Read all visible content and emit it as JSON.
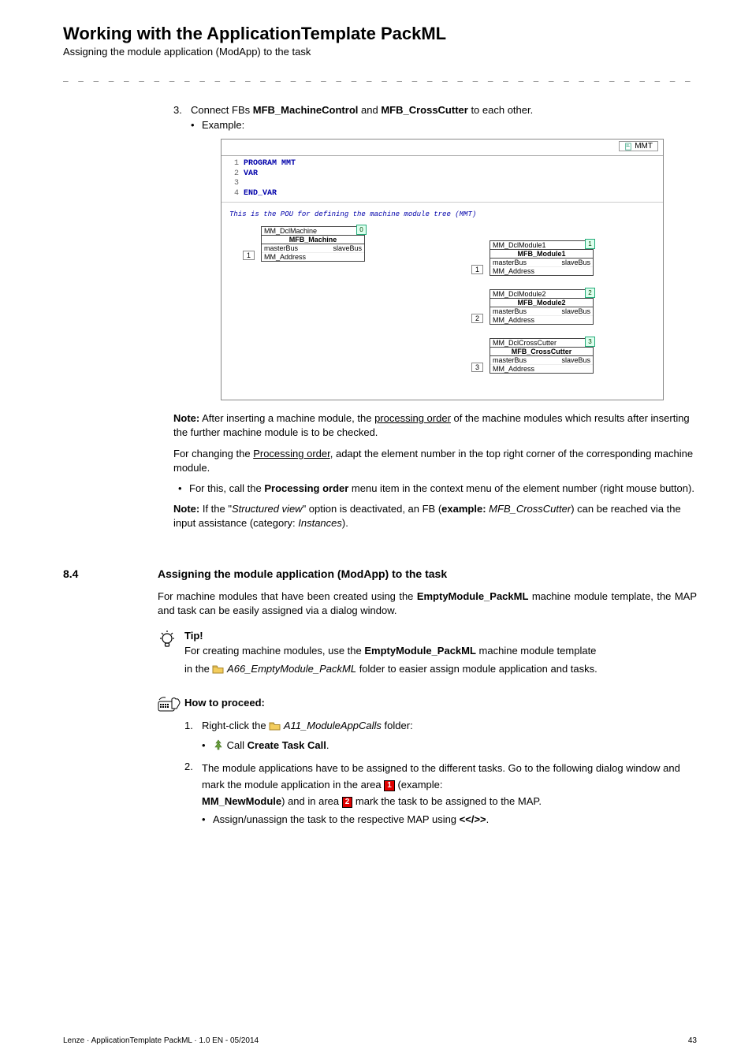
{
  "header": {
    "title": "Working with the ApplicationTemplate PackML",
    "subtitle": "Assigning the module application (ModApp) to the task"
  },
  "step3": {
    "num": "3.",
    "text_pre": "Connect FBs ",
    "fb1": "MFB_MachineControl",
    "text_mid": " and ",
    "fb2": "MFB_CrossCutter",
    "text_post": " to each other.",
    "example": "Example:"
  },
  "figure": {
    "tab": "MMT",
    "code_l1": "PROGRAM MMT",
    "code_l2": "VAR",
    "code_l3": "",
    "code_l4": "END_VAR",
    "pou_comment": "This is the POU for defining the machine module tree (MMT)",
    "blocks": [
      {
        "inst": "MM_DclMachine",
        "type": "MFB_Machine",
        "order": "0",
        "in": "1"
      },
      {
        "inst": "MM_DclModule1",
        "type": "MFB_Module1",
        "order": "1",
        "in": "1"
      },
      {
        "inst": "MM_DclModule2",
        "type": "MFB_Module2",
        "order": "2",
        "in": "2"
      },
      {
        "inst": "MM_DclCrossCutter",
        "type": "MFB_CrossCutter",
        "order": "3",
        "in": "3"
      }
    ],
    "port_l": "masterBus",
    "port_r": "slaveBus",
    "addr": "MM_Address"
  },
  "note1": {
    "label": "Note:",
    "t1": " After inserting a machine module, the ",
    "u1": "processing order",
    "t2": " of the machine modules which results after inserting the further machine module is to be checked."
  },
  "change": {
    "t1": "For changing the ",
    "u1": "Processing order",
    "t2": ", adapt the element number in the top right corner of the corresponding machine module."
  },
  "bullet_po": {
    "t1": "For this, call the ",
    "b1": "Processing order",
    "t2": " menu item in the context menu of the element number (right mouse button)."
  },
  "note2": {
    "label": "Note:",
    "t1": " If the \"",
    "i1": "Structured view",
    "t2": "\" option is deactivated, an FB (",
    "b1": "example:",
    "t3": " ",
    "i2": "MFB_CrossCutter",
    "t4": ") can be reached via the input assistance (category: ",
    "i3": "Instances",
    "t5": ")."
  },
  "section": {
    "num": "8.4",
    "title": "Assigning the module application (ModApp) to the task",
    "p1a": "For machine modules that have been created using the ",
    "p1b": "EmptyModule_PackML",
    "p1c": " machine module template, the MAP and task can be easily assigned via a dialog window."
  },
  "tip": {
    "title": "Tip!",
    "l1a": "For creating machine modules, use the ",
    "l1b": "EmptyModule_PackML",
    "l1c": " machine module template",
    "l2a": "in the ",
    "folder": " A66_EmptyModule_PackML",
    "l2b": " folder to easier assign module application and tasks."
  },
  "howto": {
    "title": "How to proceed:",
    "s1": {
      "num": "1.",
      "t1": "Right-click the ",
      "folder": " A11_ModuleAppCalls",
      "t2": " folder:",
      "call": " Call ",
      "action": "Create Task Call",
      "dot": "."
    },
    "s2": {
      "num": "2.",
      "t1": "The module applications have to be assigned to the different tasks. Go to the following dialog window and mark the module application in the area ",
      "m1": "1",
      "t2": " (example: ",
      "b1": "MM_NewModule",
      "t3": ") and in area ",
      "m2": "2",
      "t4": " mark the task to be assigned to the MAP.",
      "assign": "Assign/unassign the task to the respective MAP using ",
      "keys": "<</>>",
      "dot": "."
    }
  },
  "footer": {
    "left": "Lenze · ApplicationTemplate PackML · 1.0 EN - 05/2014",
    "right": "43"
  }
}
